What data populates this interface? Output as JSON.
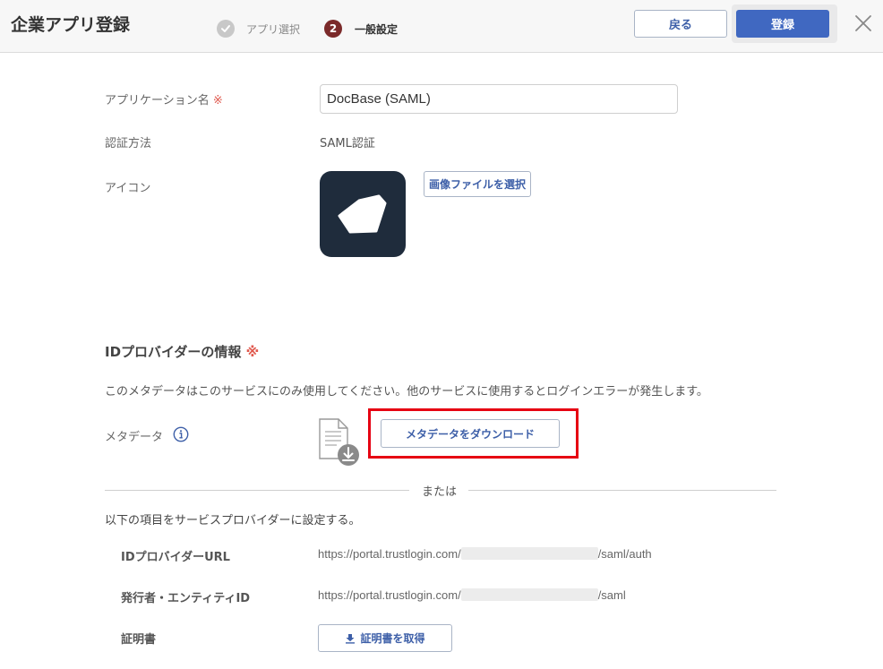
{
  "header": {
    "title": "企業アプリ登録",
    "steps": [
      {
        "number": "",
        "label": "アプリ選択",
        "state": "done"
      },
      {
        "number": "2",
        "label": "一般設定",
        "state": "current"
      }
    ],
    "back_label": "戻る",
    "register_label": "登録",
    "colors": {
      "primary": "#4068c1",
      "step_active": "#7b2a2a",
      "highlight": "#e60012"
    }
  },
  "form": {
    "app_name": {
      "label": "アプリケーション名",
      "required_mark": "※",
      "value": "DocBase (SAML)"
    },
    "auth_method": {
      "label": "認証方法",
      "value": "SAML認証"
    },
    "icon": {
      "label": "アイコン",
      "select_file_label": "画像ファイルを選択",
      "icon_name": "docbase-logo-icon"
    }
  },
  "idp": {
    "section_title": "IDプロバイダーの情報",
    "required_mark": "※",
    "notice": "このメタデータはこのサービスにのみ使用してください。他のサービスに使用するとログインエラーが発生します。",
    "metadata_label": "メタデータ",
    "download_label": "メタデータをダウンロード",
    "or_text": "または",
    "set_text": "以下の項目をサービスプロバイダーに設定する。",
    "rows": [
      {
        "label": "IDプロバイダーURL",
        "url_prefix": "https://portal.trustlogin.com/",
        "url_suffix": "/saml/auth"
      },
      {
        "label": "発行者・エンティティID",
        "url_prefix": "https://portal.trustlogin.com/",
        "url_suffix": "/saml"
      }
    ],
    "certificate_label": "証明書",
    "get_certificate_label": "証明書を取得"
  }
}
